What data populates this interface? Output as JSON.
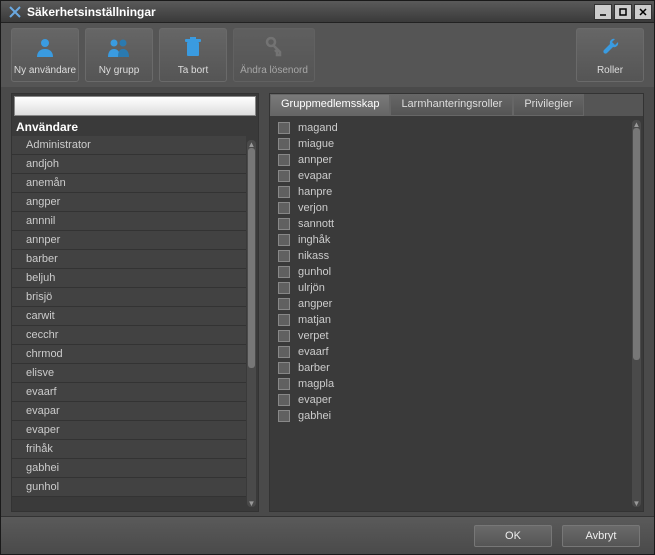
{
  "window": {
    "title": "Säkerhetsinställningar"
  },
  "toolbar": {
    "new_user": "Ny användare",
    "new_group": "Ny grupp",
    "delete": "Ta bort",
    "change_password": "Ändra lösenord",
    "roles": "Roller"
  },
  "left": {
    "header": "Användare",
    "users": [
      "Administrator",
      "andjoh",
      "anemån",
      "angper",
      "annnil",
      "annper",
      "barber",
      "beljuh",
      "brisjö",
      "carwit",
      "cecchr",
      "chrmod",
      "elisve",
      "evaarf",
      "evapar",
      "evaper",
      "frihåk",
      "gabhei",
      "gunhol"
    ]
  },
  "tabs": {
    "group_membership": "Gruppmedlemsskap",
    "alarm_roles": "Larmhanteringsroller",
    "privileges": "Privilegier"
  },
  "members": [
    "magand",
    "miague",
    "annper",
    "evapar",
    "hanpre",
    "verjon",
    "sannott",
    "inghåk",
    "nikass",
    "gunhol",
    "ulrjön",
    "angper",
    "matjan",
    "verpet",
    "evaarf",
    "barber",
    "magpla",
    "evaper",
    "gabhei"
  ],
  "footer": {
    "ok": "OK",
    "cancel": "Avbryt"
  }
}
